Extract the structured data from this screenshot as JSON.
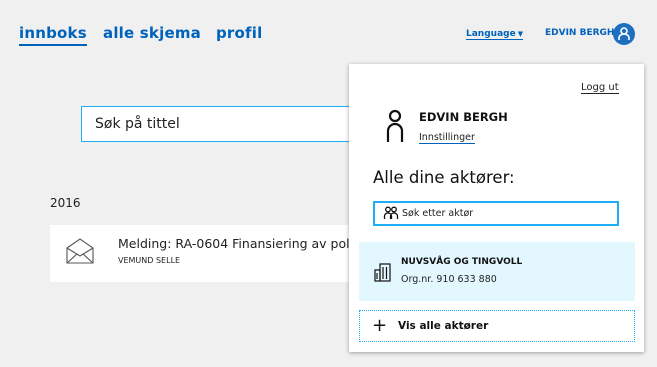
{
  "nav": {
    "items": [
      {
        "label": "innboks",
        "active": true
      },
      {
        "label": "alle skjema",
        "active": false
      },
      {
        "label": "profil",
        "active": false
      }
    ],
    "language_label": "Language",
    "user_name": "EDVIN BERGH"
  },
  "search": {
    "label": "Søk på tittel"
  },
  "inbox": {
    "year": "2016",
    "messages": [
      {
        "title": "Melding: RA-0604 Finansiering av pol",
        "sender": "VEMUND SELLE"
      }
    ]
  },
  "dropdown": {
    "logout_label": "Logg ut",
    "user_name": "EDVIN BERGH",
    "settings_label": "Innstillinger",
    "actors_heading": "Alle dine aktører:",
    "actor_search_label": "Søk etter aktør",
    "organizations": [
      {
        "name": "NUVSVÅG OG TINGVOLL",
        "org_nr": "Org.nr. 910 633 880"
      }
    ],
    "show_all_label": "Vis alle aktører"
  },
  "colors": {
    "brand_blue": "#0062ba",
    "accent_cyan": "#1eadf7",
    "org_bg": "#e3f7ff",
    "page_bg": "#f0f0f0"
  },
  "icons": [
    "chevron-down-icon",
    "user-icon",
    "envelope-icon",
    "person-icon",
    "people-icon",
    "building-icon",
    "plus-icon"
  ]
}
